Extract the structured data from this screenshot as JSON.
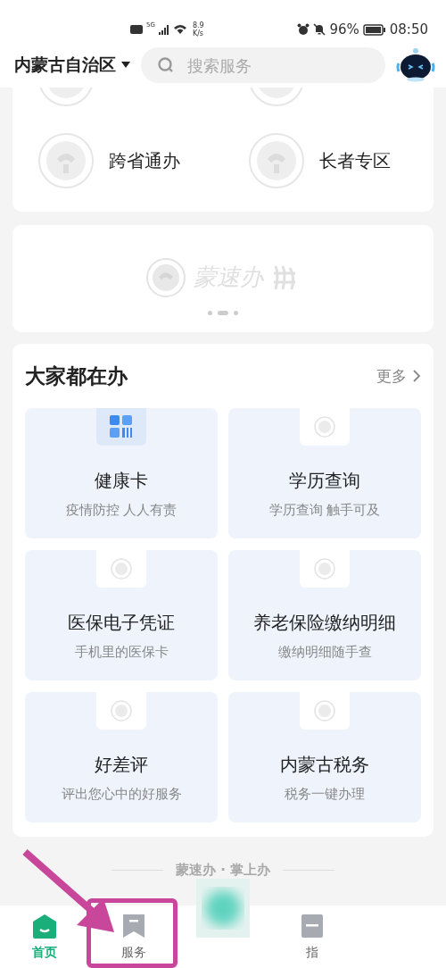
{
  "status_bar": {
    "network": "5G",
    "speed": "8.9",
    "speed_unit": "K/s",
    "battery": "96%",
    "time": "08:50"
  },
  "top_bar": {
    "region": "内蒙古自治区",
    "search": {
      "placeholder": "搜索服务"
    }
  },
  "quick_entries": [
    {
      "label": "跨省通办"
    },
    {
      "label": "长者专区"
    }
  ],
  "banner": {
    "logo_text": "蒙速办",
    "dots": [
      {
        "selected": false
      },
      {
        "selected": true
      },
      {
        "selected": false
      }
    ]
  },
  "popular": {
    "title": "大家都在办",
    "more": "更多",
    "items": [
      {
        "kind": "app",
        "title": "健康卡",
        "subtitle": "疫情防控 人人有责"
      },
      {
        "kind": "logo",
        "title": "学历查询",
        "subtitle": "学历查询 触手可及"
      },
      {
        "kind": "logo",
        "title": "医保电子凭证",
        "subtitle": "手机里的医保卡"
      },
      {
        "kind": "logo",
        "title": "养老保险缴纳明细",
        "subtitle": "缴纳明细随手查"
      },
      {
        "kind": "logo",
        "title": "好差评",
        "subtitle": "评出您心中的好服务"
      },
      {
        "kind": "logo",
        "title": "内蒙古税务",
        "subtitle": "税务一键办理"
      }
    ]
  },
  "slogan": "蒙速办 · 掌上办",
  "tab_bar": [
    {
      "kind": "home",
      "label": "首页",
      "selected": true
    },
    {
      "kind": "service",
      "label": "服务",
      "selected": false
    },
    {
      "kind": "guide",
      "label": "指",
      "selected": false
    }
  ]
}
